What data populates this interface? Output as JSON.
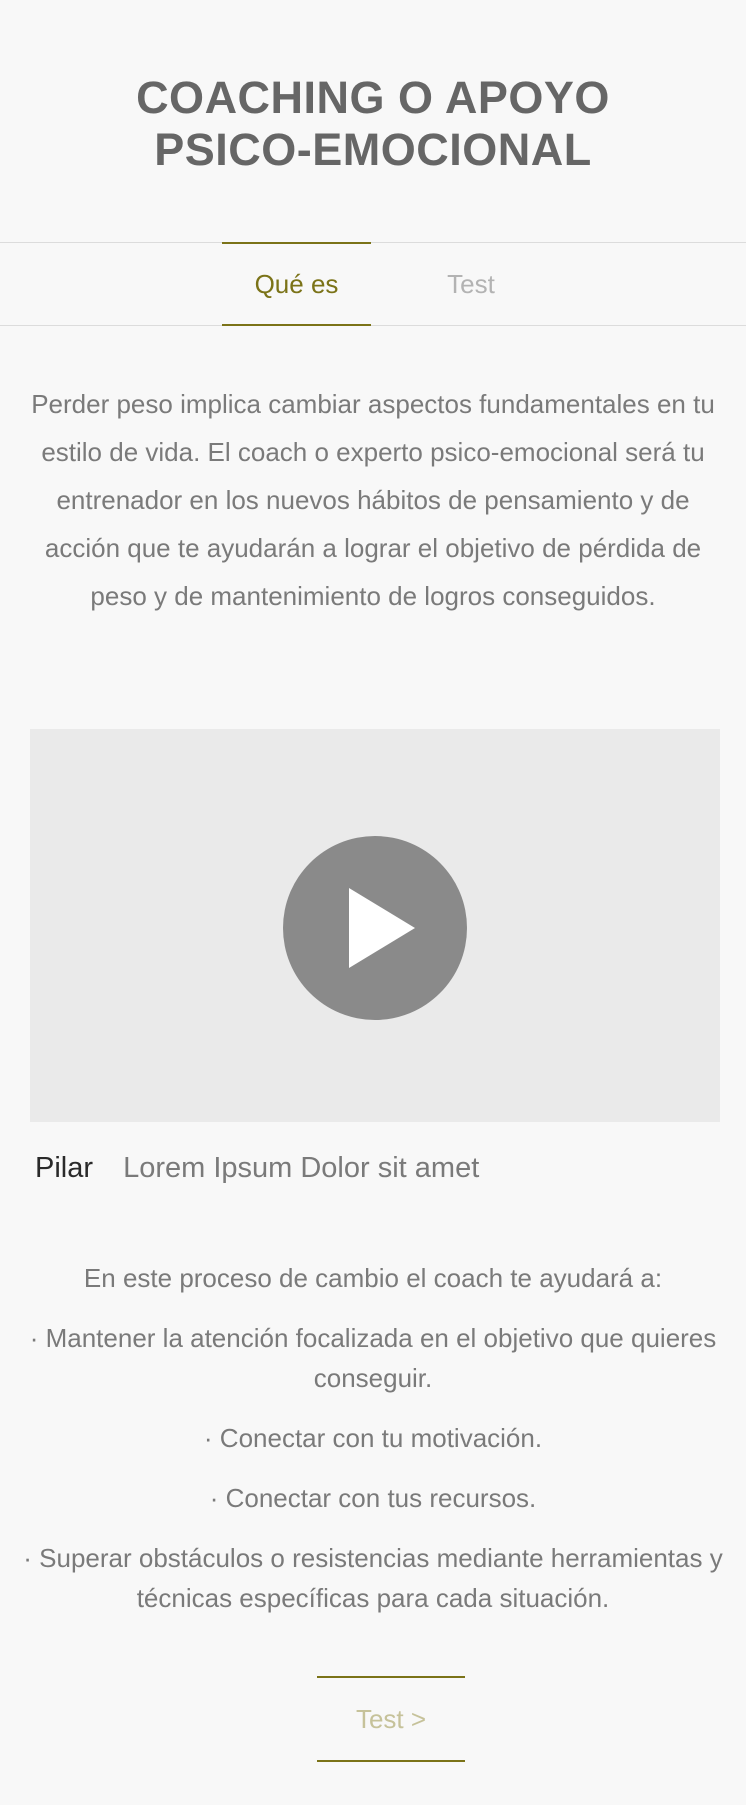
{
  "header": {
    "title_line1": "COACHING O APOYO",
    "title_line2": "PSICO-EMOCIONAL"
  },
  "tabs": [
    {
      "label": "Qué es",
      "active": true
    },
    {
      "label": "Test",
      "active": false
    }
  ],
  "intro": {
    "text": "Perder peso implica cambiar aspectos fundamentales en tu estilo de vida. El coach o experto psico-emocional será tu entrenador en los nuevos hábitos de pensamiento y de acción que te ayudarán a lograr el objetivo de pérdida de peso y de mantenimiento de logros conseguidos."
  },
  "video": {
    "icon": "play-icon",
    "caption_label": "Pilar",
    "caption_text": "Lorem Ipsum Dolor sit amet"
  },
  "benefits": {
    "lead": "En este proceso de cambio el coach te ayudará a:",
    "items": [
      "· Mantener la atención focalizada en el objetivo que quieres conseguir.",
      "· Conectar con tu motivación.",
      "· Conectar con tus recursos.",
      "· Superar obstáculos o resistencias mediante herramientas y técnicas específicas para cada situación."
    ]
  },
  "footer": {
    "test_link_label": "Test >"
  },
  "colors": {
    "accent": "#7b7318",
    "background": "#f8f8f8",
    "text": "#7a7a7a",
    "video_background": "#eaeaea",
    "play_button": "#8a8a8a"
  }
}
